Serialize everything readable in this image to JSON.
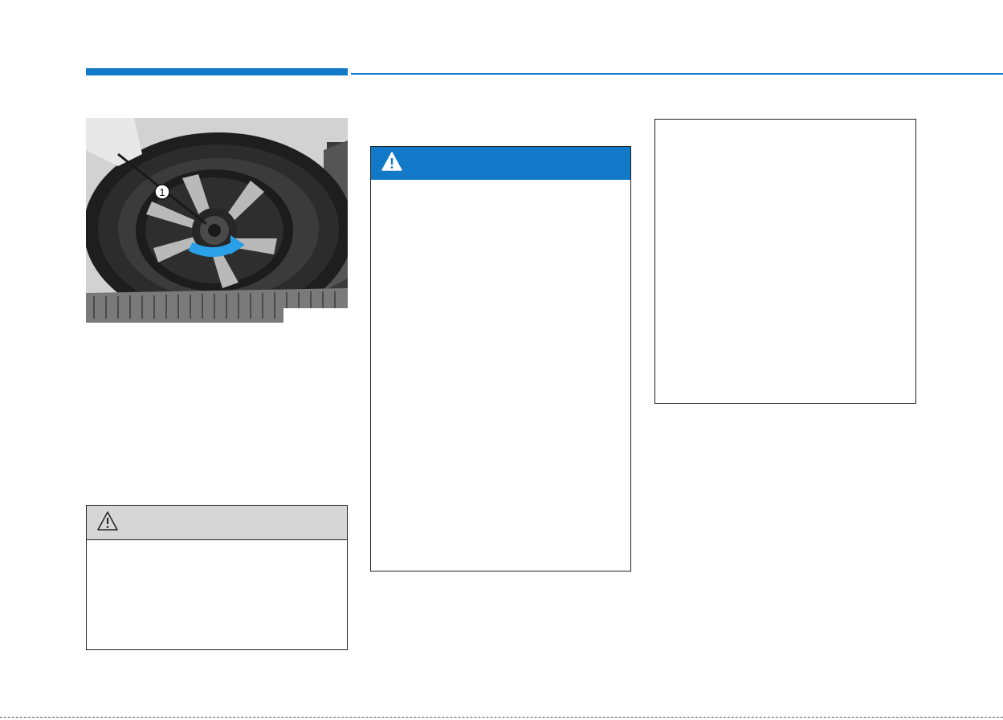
{
  "colors": {
    "accent_blue": "#1179c8",
    "caution_header": "#d6d6d6",
    "border": "#222222",
    "bottom_rule": "#555555"
  },
  "figure": {
    "callout_number": "1",
    "description_icons": [
      "rotate-arrow-icon"
    ]
  },
  "caution": {
    "icon": "caution-triangle-icon"
  },
  "warning": {
    "icon": "warning-triangle-icon"
  },
  "info_box": {}
}
